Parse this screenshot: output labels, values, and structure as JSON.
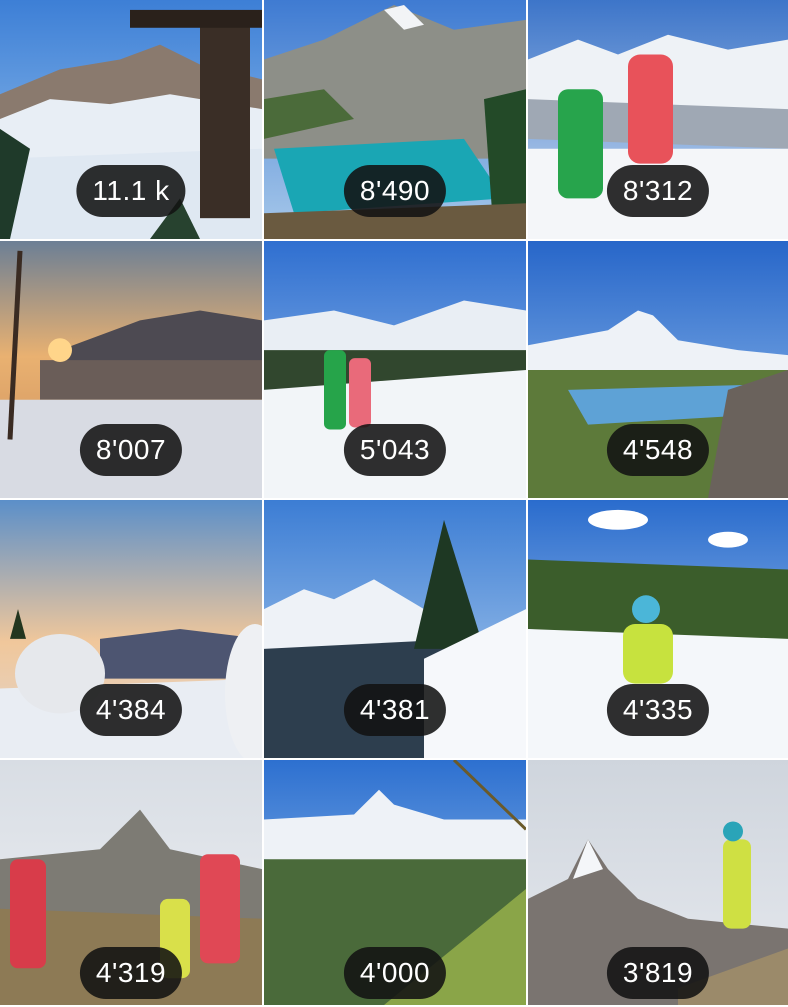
{
  "grid": {
    "tiles": [
      {
        "count": "11.1 k",
        "scene": "winter-cabin-mountains"
      },
      {
        "count": "8'490",
        "scene": "turquoise-alpine-lake"
      },
      {
        "count": "8'312",
        "scene": "kids-in-costumes-snow"
      },
      {
        "count": "8'007",
        "scene": "sunset-over-lake"
      },
      {
        "count": "5'043",
        "scene": "kids-walking-snow"
      },
      {
        "count": "4'548",
        "scene": "matterhorn-lake"
      },
      {
        "count": "4'384",
        "scene": "igloo-domes-sunset"
      },
      {
        "count": "4'381",
        "scene": "snowy-fir-tree"
      },
      {
        "count": "4'335",
        "scene": "child-yellow-jacket-snow"
      },
      {
        "count": "4'319",
        "scene": "family-hiking-matterhorn"
      },
      {
        "count": "4'000",
        "scene": "matterhorn-green-valley"
      },
      {
        "count": "3'819",
        "scene": "kids-on-rocks-matterhorn"
      }
    ]
  },
  "colors": {
    "badge_bg": "#121212",
    "badge_text": "#ffffff"
  }
}
